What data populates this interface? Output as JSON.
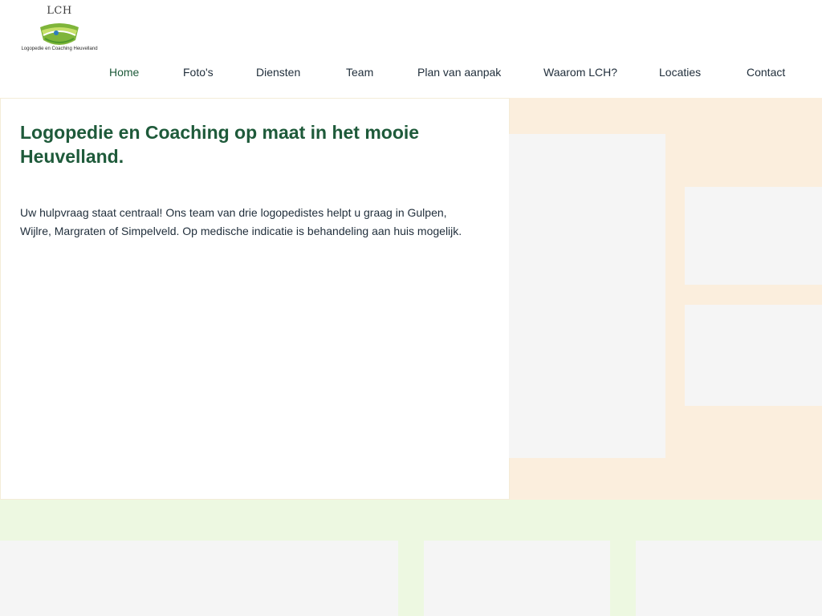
{
  "header": {
    "logo": {
      "text": "LCH",
      "tagline": "Logopedie en Coaching Heuvelland"
    },
    "nav": [
      {
        "label": "Home",
        "active": true
      },
      {
        "label": "Foto's"
      },
      {
        "label": "Diensten"
      },
      {
        "label": "Team"
      },
      {
        "label": "Plan van aanpak"
      },
      {
        "label": "Waarom LCH?"
      },
      {
        "label": "Locaties"
      },
      {
        "label": "Contact"
      }
    ]
  },
  "hero": {
    "title": "Logopedie en Coaching op maat in het mooie Heuvelland.",
    "text": "Uw hulpvraag staat centraal! Ons team van drie logopedistes helpt u graag in Gulpen, Wijlre, Margraten of Simpelveld. Op medische indicatie is behandeling aan huis mogelijk."
  },
  "colors": {
    "brand_green": "#1e5a3a",
    "hero_right_bg": "#fbeedd",
    "band_bg": "#edf8e1",
    "placeholder": "#f5f5f5"
  }
}
